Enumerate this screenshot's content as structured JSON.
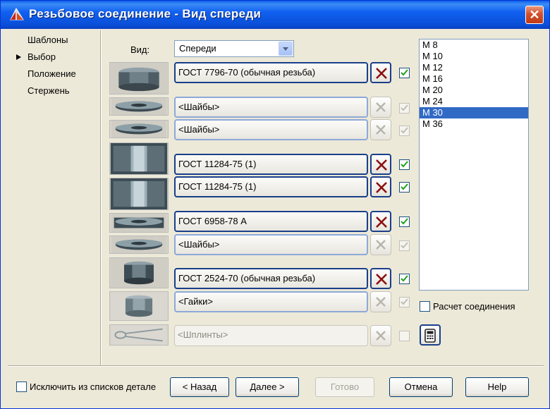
{
  "window": {
    "title": "Резьбовое соединение - Вид спереди",
    "close_label": "✕"
  },
  "steps": [
    "Шаблоны",
    "Выбор",
    "Положение",
    "Стержень"
  ],
  "active_step": "Выбор",
  "view": {
    "label": "Вид:",
    "value": "Спереди"
  },
  "parts": [
    {
      "label": "ГОСТ 7796-70  (обычная резьба)",
      "checked": true
    },
    {
      "label": "<Шайбы>",
      "checked": true
    },
    {
      "label": "<Шайбы>",
      "checked": true
    },
    {
      "label": "ГОСТ 11284-75 (1)",
      "checked": true
    },
    {
      "label": "ГОСТ 11284-75 (1)",
      "checked": true
    },
    {
      "label": "ГОСТ 6958-78  A",
      "checked": true
    },
    {
      "label": "<Шайбы>",
      "checked": true
    },
    {
      "label": "ГОСТ 2524-70  (обычная резьба)",
      "checked": true
    },
    {
      "label": "<Гайки>",
      "checked": true
    },
    {
      "label": "<Шплинты>",
      "checked": false
    }
  ],
  "sizes": [
    "M 8",
    "M 10",
    "M 12",
    "M 16",
    "M 20",
    "M 24",
    "M 30",
    "M 36"
  ],
  "selected_size": "M 30",
  "calc": {
    "label": "Расчет соединения",
    "checked": false
  },
  "exclude": {
    "label": "Исключить из списков детале",
    "checked": false
  },
  "buttons": {
    "back": "< Назад",
    "next": "Далее >",
    "done": "Готово",
    "cancel": "Отмена",
    "help": "Help"
  },
  "colors": {
    "titlebar": "#0a54e0",
    "selection": "#316ac5",
    "x_mark": "#8b1010",
    "check_mark": "#21a121"
  }
}
